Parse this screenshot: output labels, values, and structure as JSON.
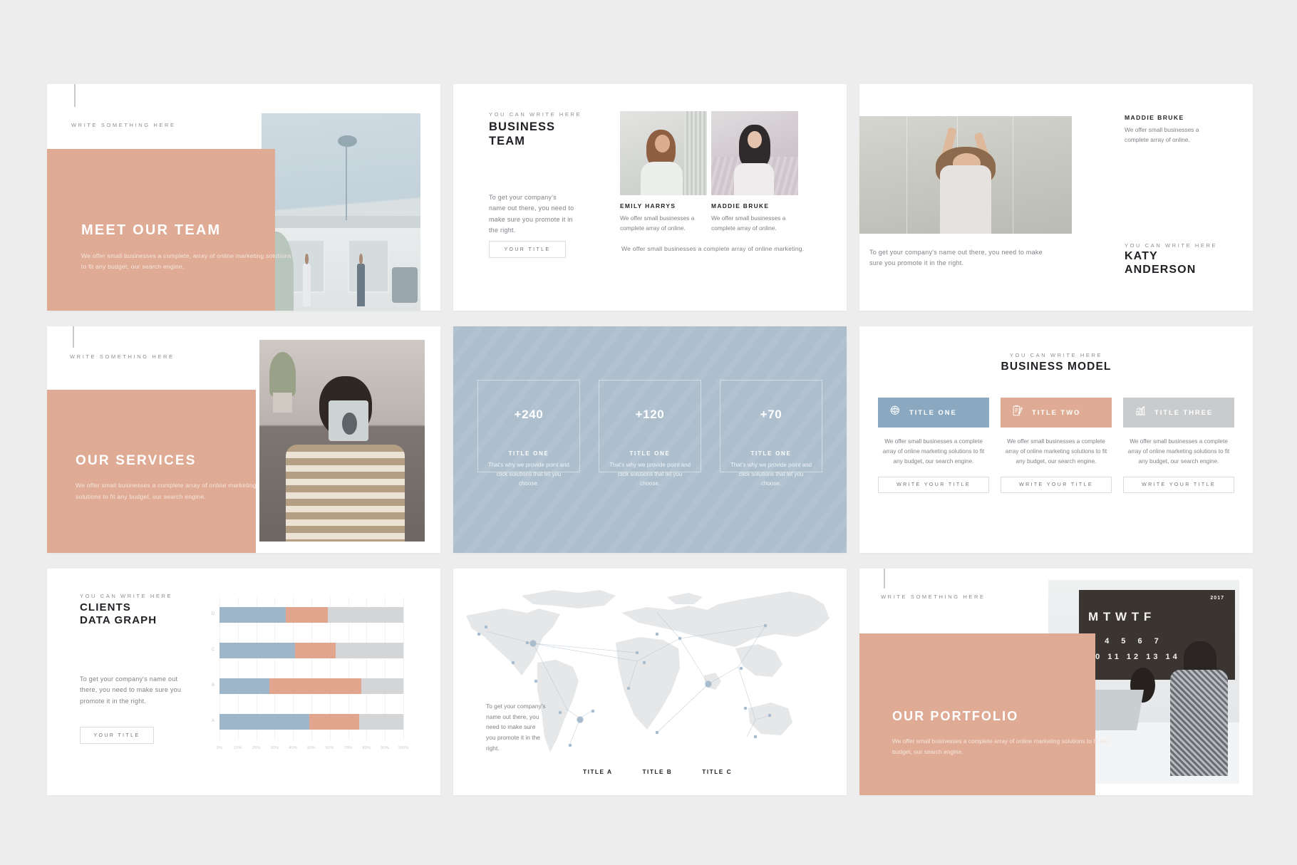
{
  "theme": {
    "background": "#ededed",
    "slide_bg": "#ffffff",
    "accent_terracotta": "#dfab95",
    "accent_blue": "#8aa8c0",
    "accent_grey": "#c9cbcd",
    "stats_bg": "#adbfcd",
    "text_dark": "#1f2024",
    "text_muted": "#7e8287"
  },
  "slides": [
    {
      "id": "meet-our-team",
      "eyebrow": "WRITE SOMETHING HERE",
      "title": "MEET OUR TEAM",
      "body": "We offer small businesses a complete, array of online marketing solutions to fit any budget, our search engine."
    },
    {
      "id": "business-team",
      "eyebrow": "YOU CAN WRITE HERE",
      "title_line1": "BUSINESS",
      "title_line2": "TEAM",
      "paragraph": "To get your company's name out there, you need to make sure you promote it in the right.",
      "button": "YOUR TITLE",
      "members": [
        {
          "name": "EMILY HARRYS",
          "body": "We offer small businesses a complete array of online."
        },
        {
          "name": "MADDIE BRUKE",
          "body": "We offer small businesses a complete array of online."
        }
      ],
      "footer": "We offer small businesses a complete array of online marketing."
    },
    {
      "id": "katy-anderson",
      "member_name": "MADDIE BRUKE",
      "member_body": "We offer small businesses a complete array of online.",
      "caption": "To get your company's name out there, you need to make sure you promote it in the right.",
      "eyebrow": "YOU CAN WRITE HERE",
      "title_line1": "KATY",
      "title_line2": "ANDERSON"
    },
    {
      "id": "our-services",
      "eyebrow": "WRITE SOMETHING HERE",
      "title": "OUR SERVICES",
      "body": "We offer small businesses a complete array of online marketing solutions to fit any budget, our search engine."
    },
    {
      "id": "stats",
      "cards": [
        {
          "number": "+240",
          "title": "TITLE ONE",
          "body": "That's why we provide point and click solutions that let you choose."
        },
        {
          "number": "+120",
          "title": "TITLE ONE",
          "body": "That's why we provide point and click solutions that let you choose."
        },
        {
          "number": "+70",
          "title": "TITLE ONE",
          "body": "That's why we provide point and click solutions that let you choose."
        }
      ]
    },
    {
      "id": "business-model",
      "eyebrow": "YOU CAN WRITE HERE",
      "title": "BUSINESS MODEL",
      "columns": [
        {
          "label": "TITLE ONE",
          "icon": "globe-network-icon",
          "color": "#8aa8c0",
          "body": "We offer small businesses a complete array of online marketing solutions to fit any budget, our search engine.",
          "button": "WRITE YOUR TITLE"
        },
        {
          "label": "TITLE TWO",
          "icon": "clipboard-pencil-icon",
          "color": "#dfab95",
          "body": "We offer small businesses a complete array of online marketing solutions to fit any budget, our search engine.",
          "button": "WRITE YOUR TITLE"
        },
        {
          "label": "TITLE THREE",
          "icon": "bar-chart-growth-icon",
          "color": "#c9cbcd",
          "body": "We offer small businesses a complete array of online marketing solutions to fit any budget, our search engine.",
          "button": "WRITE YOUR TITLE"
        }
      ]
    },
    {
      "id": "clients-data-graph",
      "eyebrow": "YOU CAN WRITE HERE",
      "title_line1": "CLIENTS",
      "title_line2": "DATA GRAPH",
      "paragraph": "To get your company's name out there, you need to make sure you promote it in the right.",
      "button": "YOUR TITLE"
    },
    {
      "id": "world-map",
      "paragraph": "To get your company's name out there, you need to make sure you promote it in the right.",
      "legend": [
        "TITLE A",
        "TITLE B",
        "TITLE C"
      ]
    },
    {
      "id": "our-portfolio",
      "eyebrow": "WRITE SOMETHING HERE",
      "title": "OUR PORTFOLIO",
      "body": "We offer small businesses a complete array of online marketing solutions to fit any budget, our search engine.",
      "photo_calendar_year": "2017",
      "photo_calendar_days": "M T W T F"
    }
  ],
  "chart_data": {
    "type": "bar",
    "orientation": "horizontal",
    "stacked": true,
    "title": "CLIENTS DATA GRAPH",
    "categories": [
      "D",
      "C",
      "B",
      "A"
    ],
    "series": [
      {
        "name": "Series 1",
        "color": "#9db6ca",
        "values": [
          36,
          41,
          27,
          49
        ]
      },
      {
        "name": "Series 2",
        "color": "#e0a58c",
        "values": [
          23,
          22,
          50,
          27
        ]
      },
      {
        "name": "Series 3",
        "color": "#d4d5d6",
        "values": [
          41,
          37,
          23,
          24
        ]
      }
    ],
    "xlabel": "",
    "ylabel": "",
    "xlim": [
      0,
      100
    ],
    "xticks": [
      "0%",
      "10%",
      "20%",
      "30%",
      "40%",
      "50%",
      "60%",
      "70%",
      "80%",
      "90%",
      "100%"
    ],
    "grid": true,
    "legend": false
  }
}
